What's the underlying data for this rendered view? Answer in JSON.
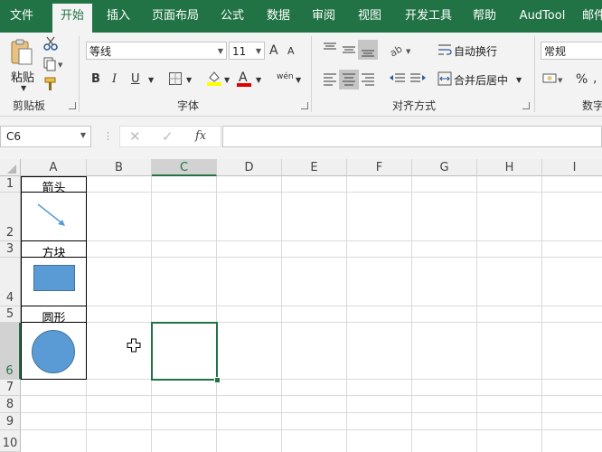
{
  "tabs": [
    "文件",
    "开始",
    "插入",
    "页面布局",
    "公式",
    "数据",
    "审阅",
    "视图",
    "开发工具",
    "帮助",
    "AudTool",
    "邮件"
  ],
  "ribbon": {
    "clipboard": {
      "paste_label": "粘贴",
      "group_label": "剪贴板"
    },
    "font": {
      "font_name": "等线",
      "font_size": "11",
      "group_label": "字体",
      "bold": "B",
      "italic": "I",
      "underline": "U",
      "font_color_letter": "A",
      "grow_font": "A",
      "shrink_font": "A",
      "phonetic": "wén"
    },
    "alignment": {
      "wrap_text": "自动换行",
      "merge_center": "合并后居中",
      "group_label": "对齐方式"
    },
    "number": {
      "format": "常规",
      "percent": "%",
      "group_label": "数字"
    }
  },
  "formula_bar": {
    "name_box": "C6",
    "fx": "fx",
    "value": ""
  },
  "columns": [
    "A",
    "B",
    "C",
    "D",
    "E",
    "F",
    "G",
    "H",
    "I"
  ],
  "rows": [
    "1",
    "2",
    "3",
    "4",
    "5",
    "6",
    "7",
    "8",
    "9",
    "10"
  ],
  "cells": {
    "A1": "箭头",
    "A3": "方块",
    "A5": "圆形"
  },
  "selected_cell": "C6",
  "colors": {
    "accent": "#217346",
    "shape_fill": "#5b9bd5",
    "shape_border": "#41719c",
    "arrow": "#5b9bd5"
  }
}
